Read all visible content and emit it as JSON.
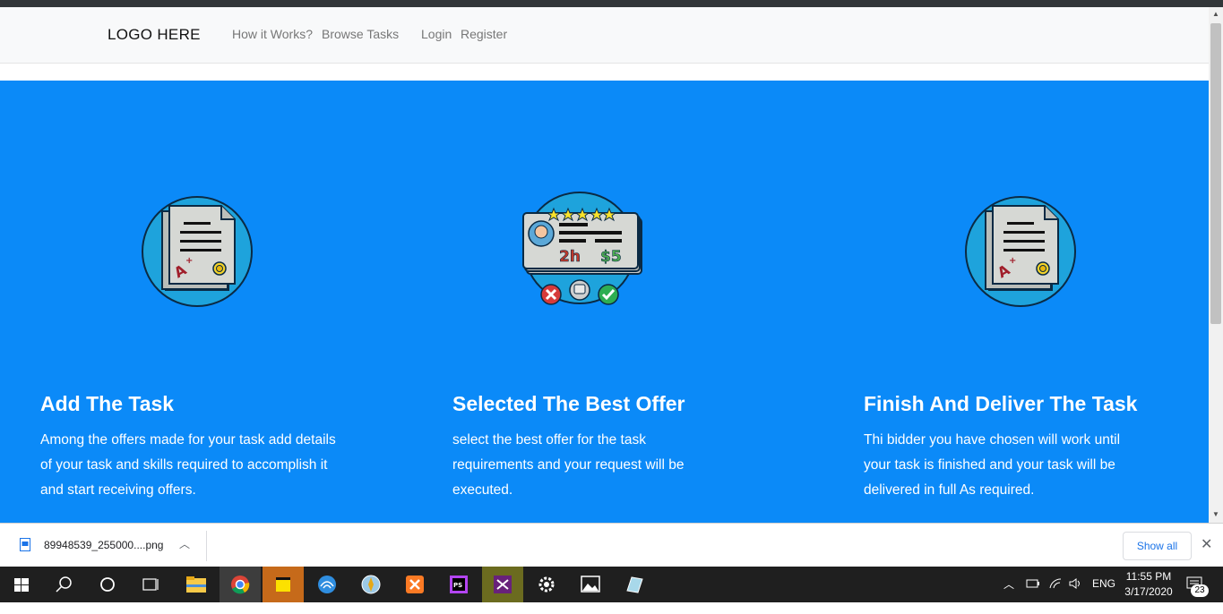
{
  "navbar": {
    "logo": "LOGO HERE",
    "links": [
      "How it Works?",
      "Browse Tasks",
      "Login",
      "Register"
    ]
  },
  "columns": [
    {
      "title": "Add The Task",
      "text": "Among the offers made for your task add details of your task and skills required to accomplish it and start receiving offers.",
      "icon": "certificate-icon"
    },
    {
      "title": "Selected The Best Offer",
      "text": "select the best offer for the task requirements and your request will be executed.",
      "icon": "offer-card-icon",
      "card_time": "2h",
      "card_price": "$5",
      "stars": 5
    },
    {
      "title": "Finish And Deliver The Task",
      "text": "Thi bidder you have chosen will work until your task is finished and your task will be delivered in full As required.",
      "icon": "certificate-icon"
    }
  ],
  "colors": {
    "hero": "#0b8af8",
    "navbar": "#f8f9fa"
  },
  "download": {
    "filename": "89948539_255000....png",
    "show_all": "Show all"
  },
  "taskbar": {
    "language": "ENG",
    "time": "11:55 PM",
    "date": "3/17/2020",
    "notifications": "23"
  }
}
